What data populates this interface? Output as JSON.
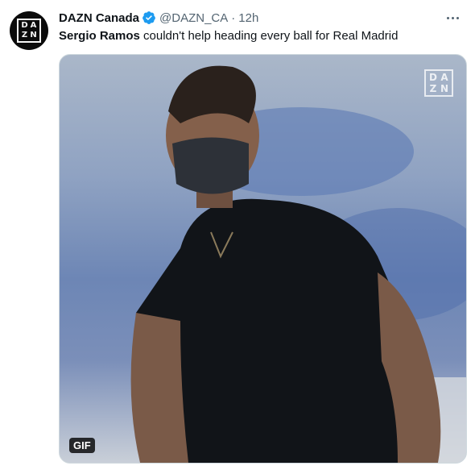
{
  "tweet": {
    "display_name": "DAZN Canada",
    "handle": "@DAZN_CA",
    "separator": "·",
    "time": "12h",
    "text_bold": "Sergio Ramos",
    "text_rest": " couldn't help heading every ball for Real Madrid"
  },
  "avatar": {
    "letters": [
      "D",
      "A",
      "Z",
      "N"
    ]
  },
  "media": {
    "watermark_letters": [
      "D",
      "A",
      "Z",
      "N"
    ],
    "badge": "GIF"
  },
  "icons": {
    "verified": "verified-badge-icon",
    "more": "more-horizontal-icon"
  },
  "colors": {
    "verified": "#1d9bf0",
    "secondary_text": "#536471",
    "avatar_bg": "#0b0b0b"
  }
}
